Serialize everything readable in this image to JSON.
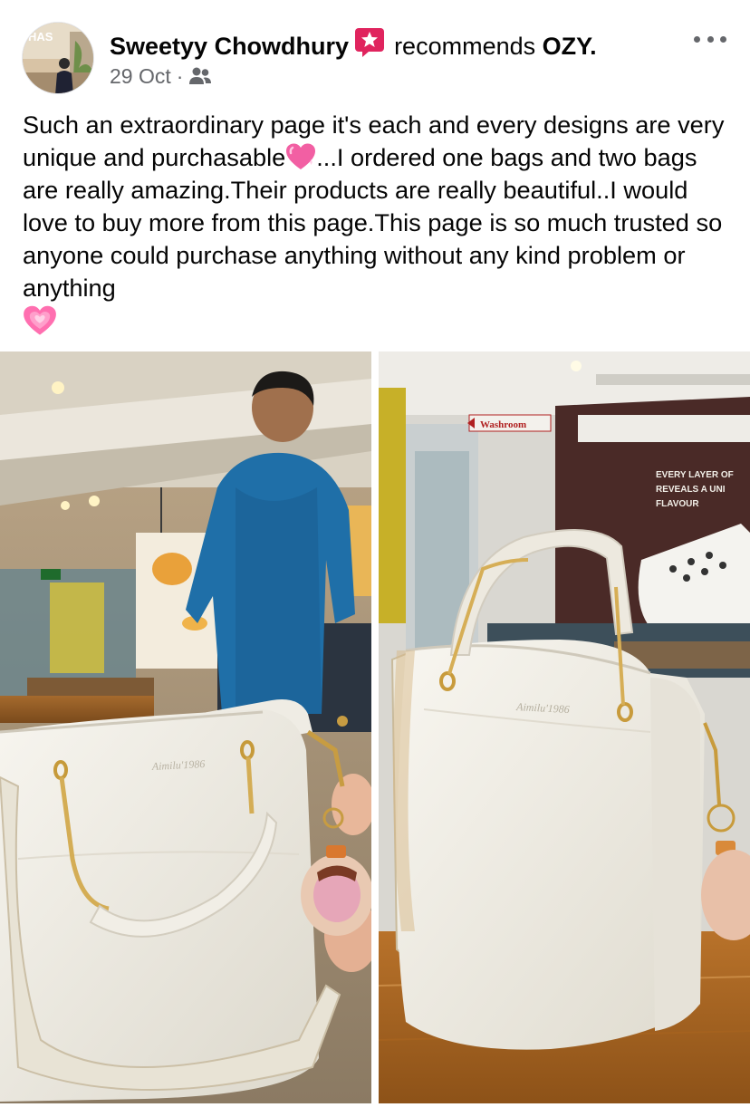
{
  "post": {
    "author": "Sweetyy Chowdhury",
    "recommends_text": "recommends",
    "page": "OZY.",
    "date": "29 Oct",
    "separator": "·",
    "audience_icon": "friends-icon",
    "avatar_sign": "HAS",
    "body_parts": [
      "Such an extraordinary page it's each and every designs are very unique and purchasable",
      "...I ordered one bags and two bags are really amazing.Their products  are really beautiful..I would love to buy more from this page.This page is so much trusted so anyone could purchase anything without any kind problem or anything"
    ]
  },
  "photos": {
    "left": {
      "bag_brand": "Aimilu'1986"
    },
    "right": {
      "bag_brand": "Aimilu'1986",
      "washroom_sign": "Washroom",
      "wall_text": [
        "EVERY LAYER OF",
        "REVEALS A UNI",
        "FLAVOUR"
      ]
    }
  },
  "colors": {
    "author": "#050505",
    "meta": "#65676b",
    "badge": "#e0245e",
    "heart": "#f25fa3"
  }
}
